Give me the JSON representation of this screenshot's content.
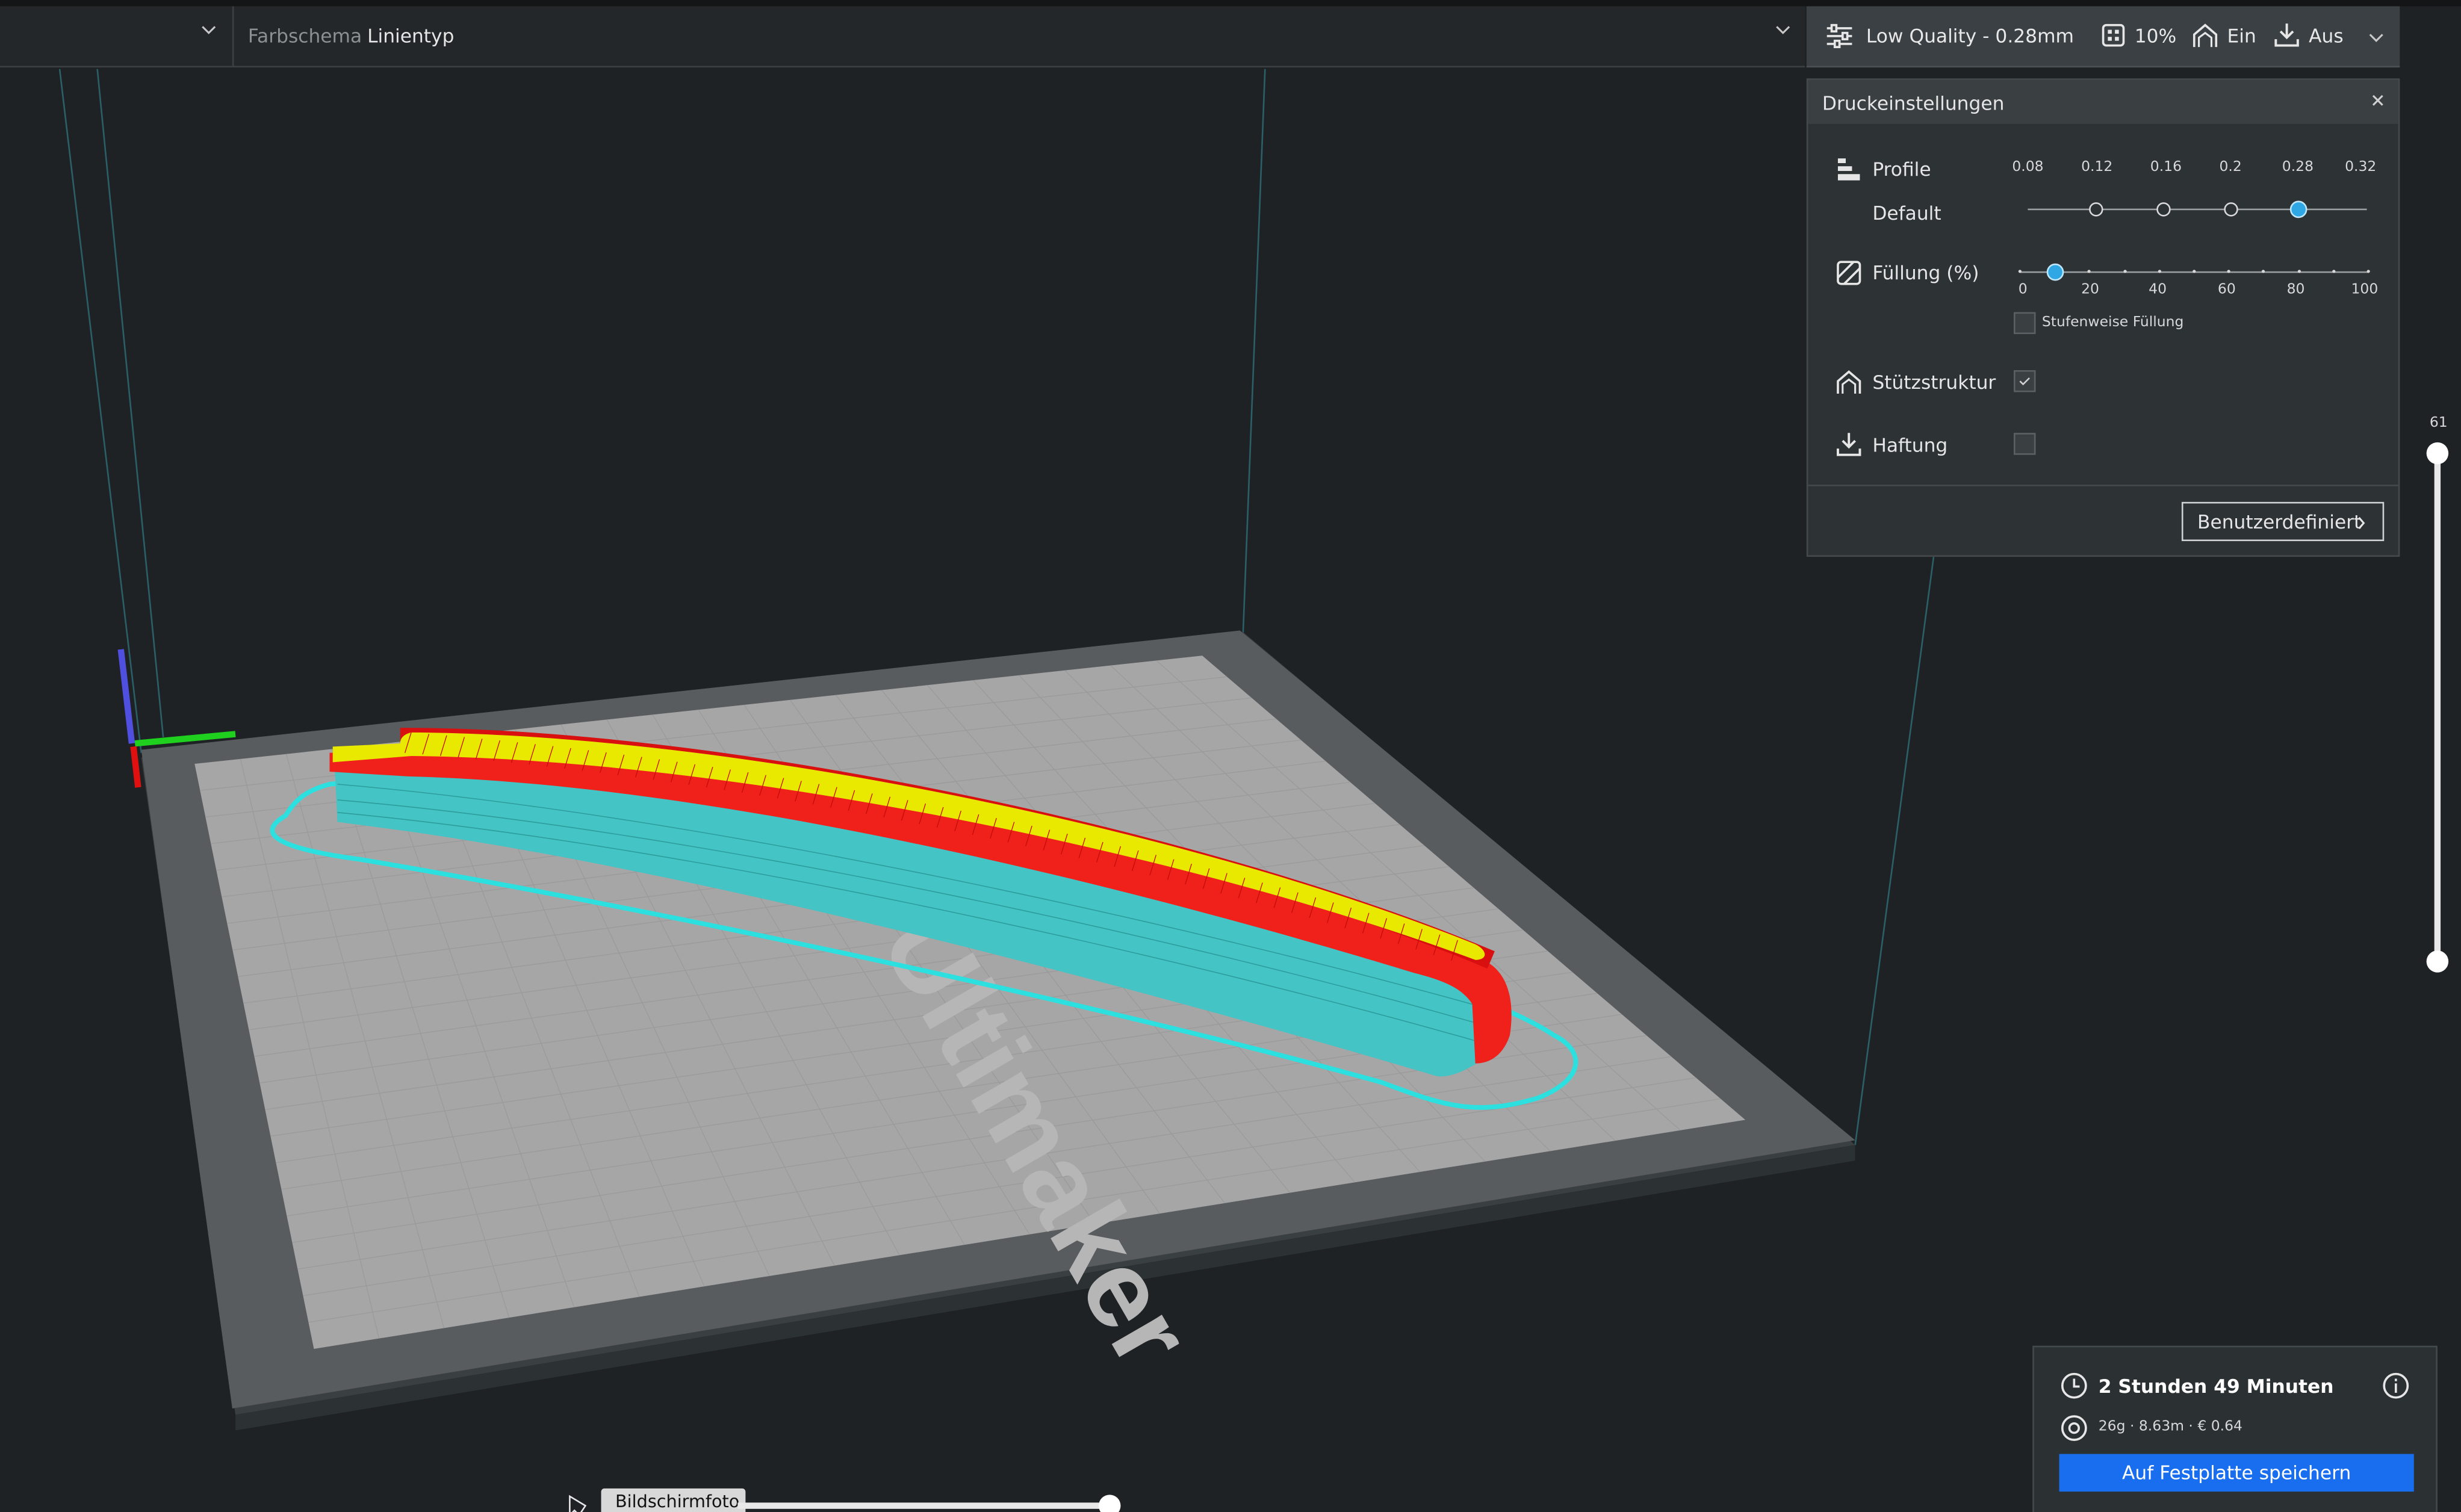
{
  "toolbar": {
    "left_dropdown_icon": "chevron-down-icon",
    "colorscheme_label": "Farbschema",
    "colorscheme_value": "Linientyp"
  },
  "print_summary": {
    "profile": "Low Quality - 0.28mm",
    "infill": "10%",
    "support": "Ein",
    "adhesion": "Aus",
    "icons": [
      "settings-sliders-icon",
      "infill-icon",
      "support-icon",
      "adhesion-icon",
      "chevron-down-icon"
    ]
  },
  "print_settings": {
    "title": "Druckeinstellungen",
    "profile_label": "Profile",
    "profile_sub": "Default",
    "layer_heights": [
      "0.08",
      "0.12",
      "0.16",
      "0.2",
      "0.28",
      "0.32"
    ],
    "selected_layer_height": "0.28",
    "infill_label": "Füllung (%)",
    "infill_ticks": [
      "0",
      "20",
      "40",
      "60",
      "80",
      "100"
    ],
    "infill_value": 10,
    "gradual_infill_label": "Stufenweise Füllung",
    "gradual_infill_checked": false,
    "support_label": "Stützstruktur",
    "support_checked": true,
    "adhesion_label": "Haftung",
    "adhesion_checked": false,
    "custom_button": "Benutzerdefiniert"
  },
  "layer_view": {
    "current_layer": "61"
  },
  "job": {
    "time": "2 Stunden 49 Minuten",
    "material": "26g · 8.63m · € 0.64",
    "save_button": "Auf Festplatte speichern",
    "icons": [
      "clock-icon",
      "spool-icon",
      "info-icon"
    ]
  },
  "bottom": {
    "screenshot_tooltip": "Bildschirmfoto"
  },
  "colors": {
    "background": "#1e2224",
    "accent_blue": "#196ef0",
    "slider_active": "#2fa7e4",
    "wall_outer": "#ff1a1a",
    "wall_top": "#e8e800",
    "support_cyan": "#3ec7c7"
  }
}
